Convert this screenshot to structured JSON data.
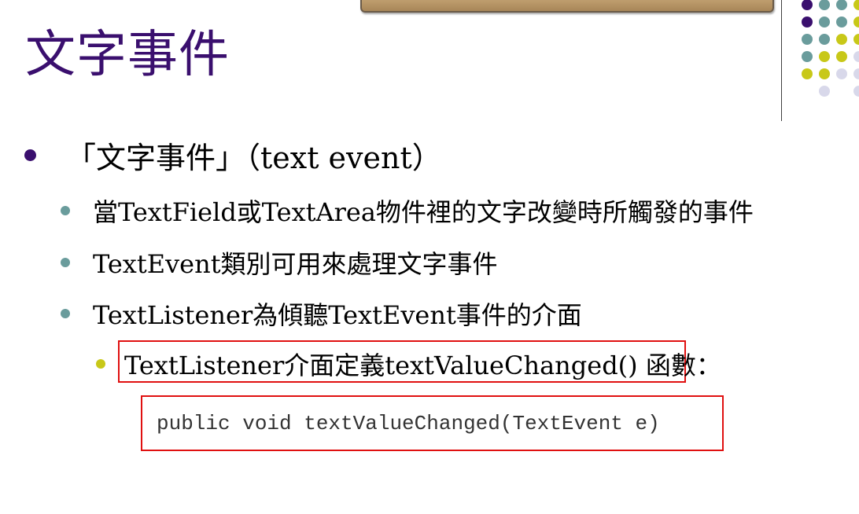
{
  "slide": {
    "title": "文字事件",
    "bullet_main": "「文字事件」（text event）",
    "sub_bullets": [
      "當TextField或TextArea物件裡的文字改變時所觸發的事件",
      "TextEvent類別可用來處理文字事件",
      "TextListener為傾聽TextEvent事件的介面"
    ],
    "sub_sub_bullet": "TextListener介面定義textValueChanged() 函數：",
    "code_line": "public void textValueChanged(TextEvent e)"
  },
  "colors": {
    "title": "#3a0f6e",
    "bullet_level1": "#3a0f6e",
    "bullet_level2": "#6a9c9c",
    "bullet_level3": "#c8c818",
    "highlight_border": "#e01010"
  }
}
